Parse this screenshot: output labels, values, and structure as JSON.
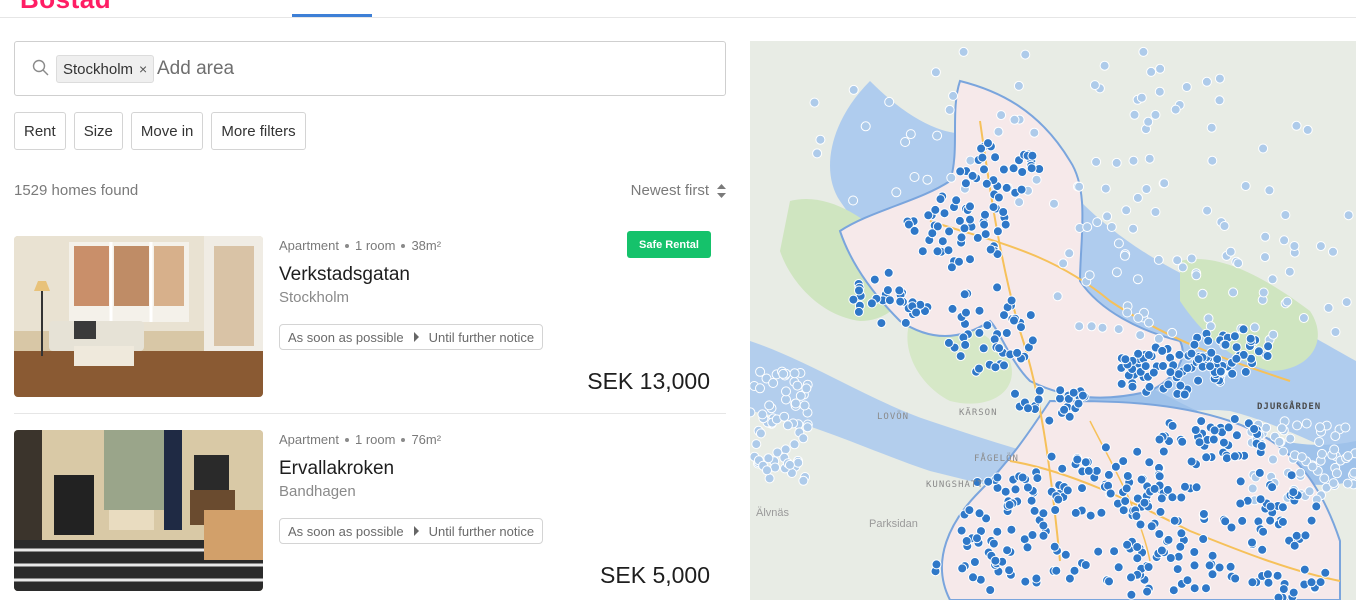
{
  "brand": {
    "logo": "Bostad"
  },
  "search": {
    "chip_label": "Stockholm",
    "chip_remove": "×",
    "placeholder": "Add area"
  },
  "filters": [
    "Rent",
    "Size",
    "Move in",
    "More filters"
  ],
  "results": {
    "count_text": "1529 homes found",
    "sort_label": "Newest first"
  },
  "listings": [
    {
      "type": "Apartment",
      "rooms": "1 room",
      "size": "38m²",
      "title": "Verkstadsgatan",
      "city": "Stockholm",
      "move_in": "As soon as possible",
      "move_out": "Until further notice",
      "price": "SEK 13,000",
      "badge": "Safe Rental"
    },
    {
      "type": "Apartment",
      "rooms": "1 room",
      "size": "76m²",
      "title": "Ervallakroken",
      "city": "Bandhagen",
      "move_in": "As soon as possible",
      "move_out": "Until further notice",
      "price": "SEK 5,000"
    }
  ],
  "map": {
    "labels": {
      "lovon": "LOVÖN",
      "karson": "KÄRSON",
      "fagelon": "FÅGELÖN",
      "kungshatt": "KUNGSHATT",
      "djurgarden": "DJURGÅRDEN",
      "alvnas": "Älvnäs",
      "parksidan": "Parksidan"
    },
    "colors": {
      "marker": "#2f78c8",
      "marker_faded": "#aecbea",
      "water": "#a9c9ee",
      "land": "#e8ece5",
      "park": "#cfe5c0",
      "city": "#f6e9ea"
    }
  }
}
